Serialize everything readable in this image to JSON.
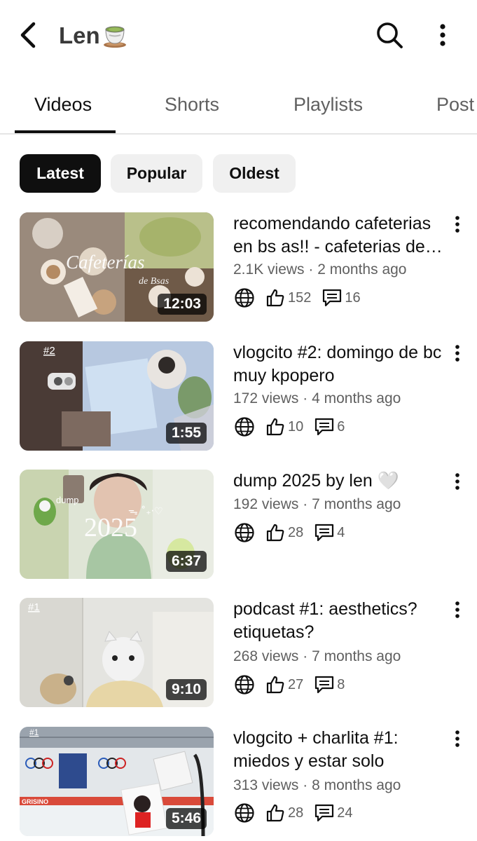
{
  "header": {
    "back_icon": "chevron-left-icon",
    "channel_name": "Len",
    "channel_emoji": "teacup-icon",
    "search_icon": "search-icon",
    "more_icon": "vertical-dots-icon"
  },
  "tabs": [
    {
      "label": "Videos",
      "active": true
    },
    {
      "label": "Shorts",
      "active": false
    },
    {
      "label": "Playlists",
      "active": false
    },
    {
      "label": "Post",
      "active": false
    }
  ],
  "filter_chips": [
    {
      "label": "Latest",
      "active": true
    },
    {
      "label": "Popular",
      "active": false
    },
    {
      "label": "Oldest",
      "active": false
    }
  ],
  "videos": [
    {
      "title": "recomendando cafeterias en bs as!! - cafeterias de bsas",
      "views": "2.1K views",
      "age": "2 months ago",
      "duration": "12:03",
      "likes": "152",
      "comments": "16",
      "thumb_text": "Cafeterías",
      "thumb_subtext": "de Bsas"
    },
    {
      "title": "vlogcito #2: domingo de bc muy kpopero",
      "views": "172 views",
      "age": "4 months ago",
      "duration": "1:55",
      "likes": "10",
      "comments": "6",
      "thumb_text": "#2"
    },
    {
      "title": "dump 2025 by len 🤍",
      "views": "192 views",
      "age": "7 months ago",
      "duration": "6:37",
      "likes": "28",
      "comments": "4",
      "thumb_text": "2025",
      "thumb_subtext": "dump"
    },
    {
      "title": "podcast #1: aesthetics? etiquetas?",
      "views": "268 views",
      "age": "7 months ago",
      "duration": "9:10",
      "likes": "27",
      "comments": "8",
      "thumb_text": "#1"
    },
    {
      "title": "vlogcito + charlita #1: miedos y estar solo",
      "views": "313 views",
      "age": "8 months ago",
      "duration": "5:46",
      "likes": "28",
      "comments": "24",
      "thumb_text": "#1",
      "thumb_subtext": "GRISINO"
    }
  ],
  "separator": "·",
  "icons": {
    "visibility": "globe-icon",
    "likes": "thumbs-up-icon",
    "comments": "comment-icon",
    "row_more": "vertical-dots-icon"
  },
  "colors": {
    "text_primary": "#0f0f0f",
    "text_secondary": "#606060",
    "chip_active_bg": "#0f0f0f",
    "chip_inactive_bg": "#f0f0f0",
    "divider": "#e5e5e5"
  }
}
